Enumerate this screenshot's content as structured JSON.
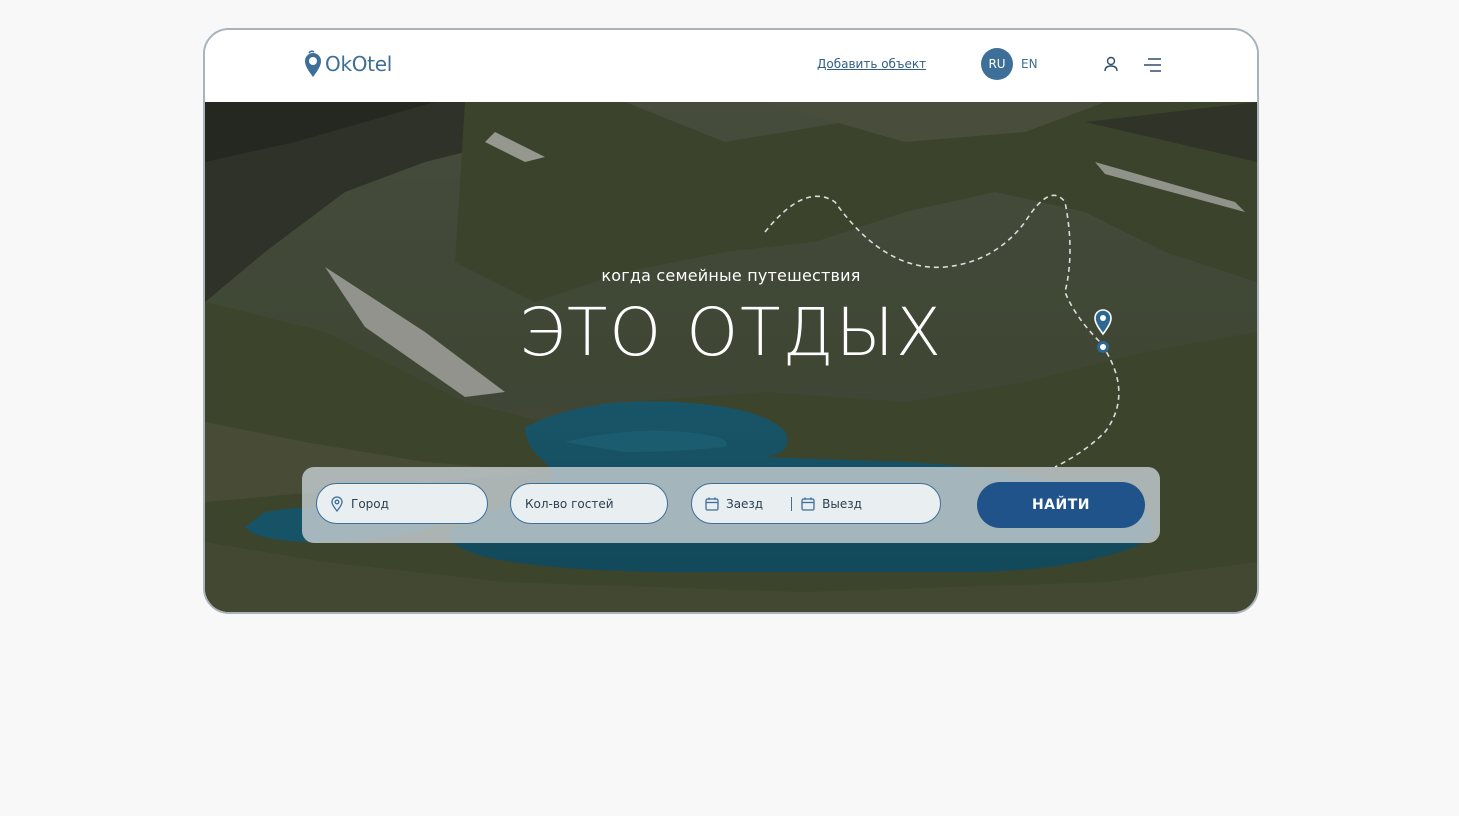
{
  "header": {
    "logo_text": "OkOtel",
    "add_property_link": "Добавить объект",
    "languages": [
      "RU",
      "EN"
    ],
    "active_language": "RU",
    "icons": [
      "logo-pin-icon",
      "user-icon",
      "menu-icon"
    ]
  },
  "hero": {
    "subtitle": "когда семейные путешествия",
    "title": "ЭТО ОТДЫХ",
    "icons": [
      "map-pin-icon",
      "route-dot-icon"
    ]
  },
  "search": {
    "city_placeholder": "Город",
    "guests_placeholder": "Кол-во гостей",
    "checkin_placeholder": "Заезд",
    "checkout_placeholder": "Выезд",
    "submit_label": "НАЙТИ",
    "icons": [
      "location-icon",
      "calendar-icon"
    ]
  },
  "colors": {
    "brand": "#3e6f99",
    "button": "#1f5389",
    "page_background": "#f8f8f8",
    "frame_border": "#a8b3bb"
  }
}
